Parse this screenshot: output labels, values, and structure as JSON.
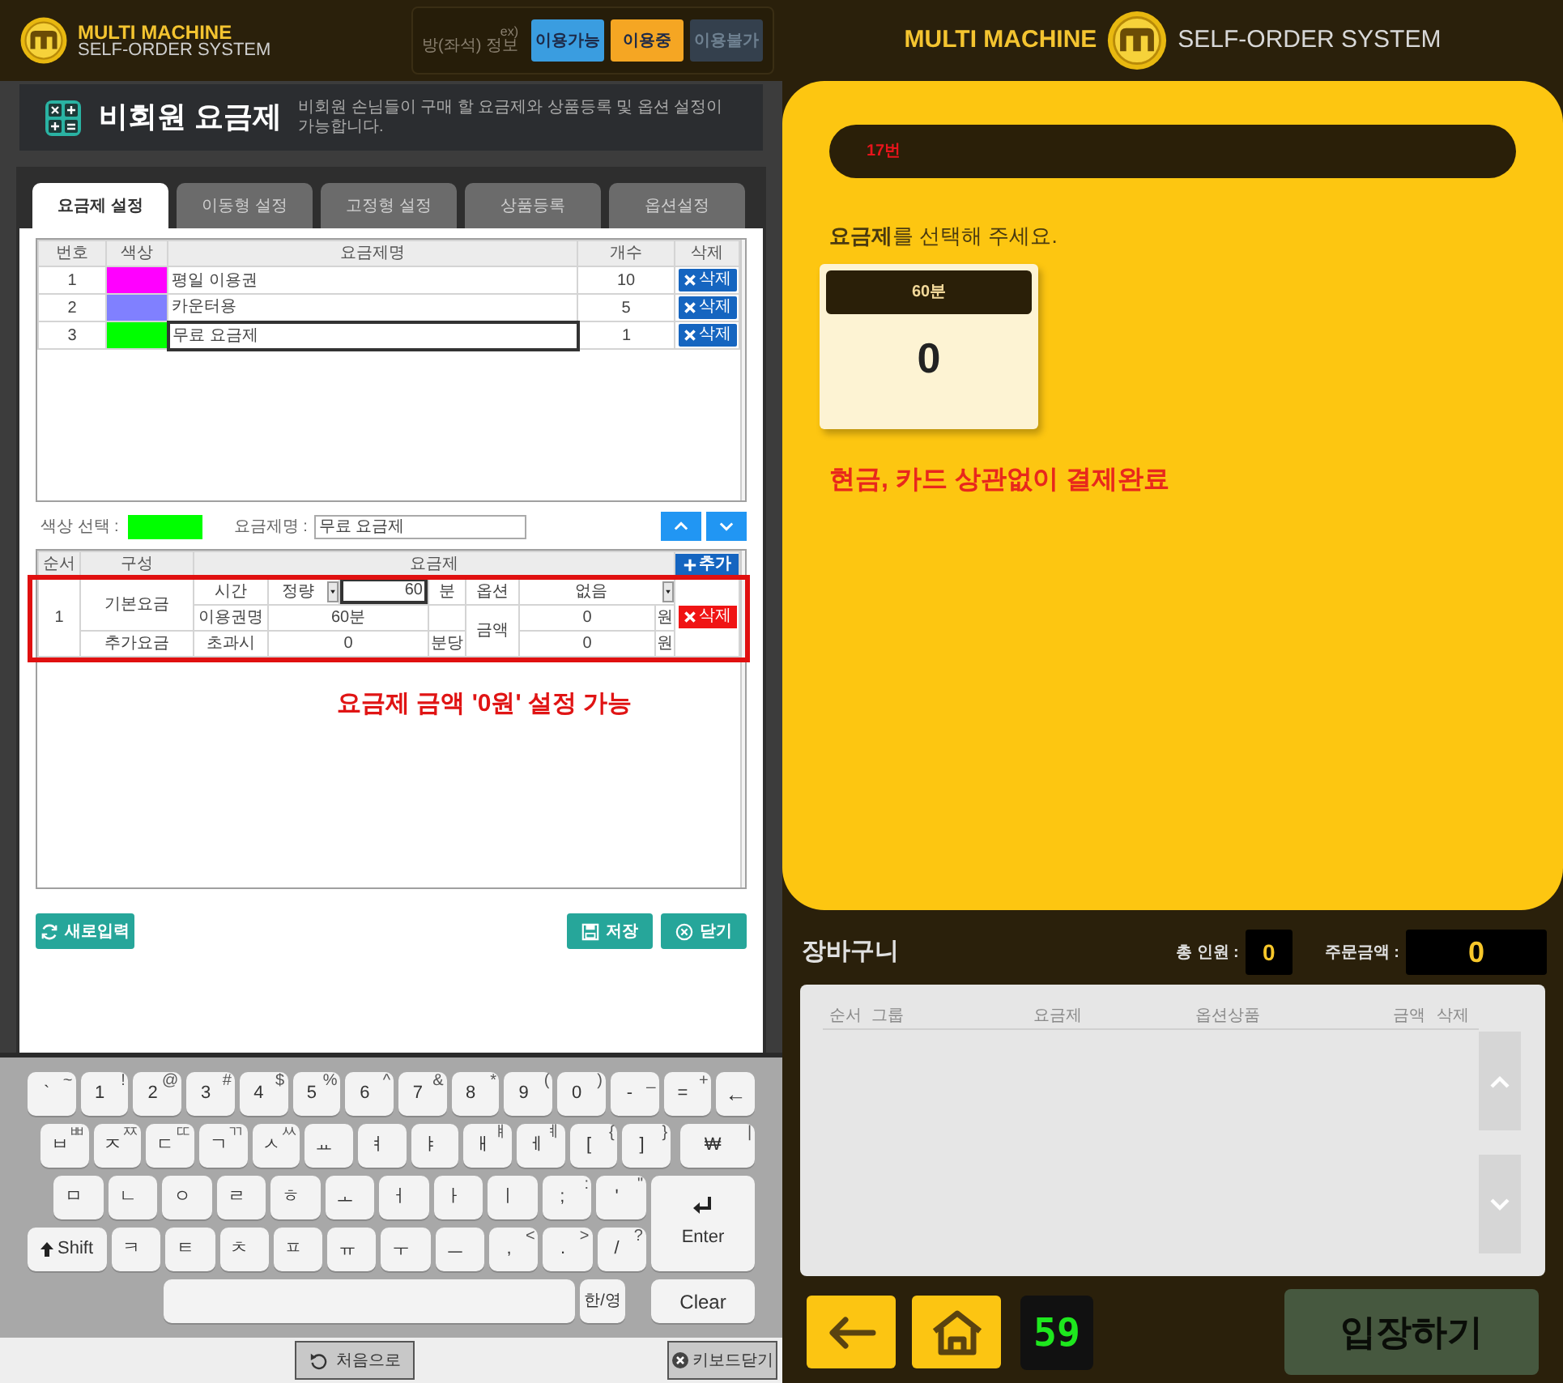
{
  "admin": {
    "header": {
      "brand_line1": "MULTI MACHINE",
      "brand_line2": "SELF-ORDER SYSTEM",
      "legend_note": "ex)",
      "legend_label": "방(좌석) 정보",
      "legend": [
        {
          "label": "이용가능",
          "color": "#3a9de0"
        },
        {
          "label": "이용중",
          "color": "#f5a623"
        },
        {
          "label": "이용불가",
          "color": "#34404d"
        }
      ]
    },
    "page_title": "비회원 요금제",
    "page_description": "비회원 손님들이 구매 할 요금제와 상품등록 및 옵션 설정이 가능합니다.",
    "tabs": [
      {
        "label": "요금제 설정",
        "selected": true
      },
      {
        "label": "이동형 설정",
        "selected": false
      },
      {
        "label": "고정형 설정",
        "selected": false
      },
      {
        "label": "상품등록",
        "selected": false
      },
      {
        "label": "옵션설정",
        "selected": false
      }
    ],
    "plan_table": {
      "columns": [
        "번호",
        "색상",
        "요금제명",
        "개수",
        "삭제"
      ],
      "rows": [
        {
          "number": "1",
          "color": "#ff00ff",
          "name": "평일 이용권",
          "count": "10",
          "delete": "삭제",
          "selected": false
        },
        {
          "number": "2",
          "color": "#8080ff",
          "name": "카운터용",
          "count": "5",
          "delete": "삭제",
          "selected": false
        },
        {
          "number": "3",
          "color": "#00ff00",
          "name": "무료 요금제",
          "count": "1",
          "delete": "삭제",
          "selected": true
        }
      ]
    },
    "color_select": {
      "label": "색상 선택 :",
      "color": "#00ff00"
    },
    "plan_name": {
      "label": "요금제명 :",
      "value": "무료 요금제"
    },
    "detail_table": {
      "columns": [
        "순서",
        "구성",
        "요금제"
      ],
      "add_button": "추가",
      "row": {
        "order": "1",
        "base_label": "기본요금",
        "time_label": "시간",
        "time_mode": "정량",
        "time_value": "60",
        "time_unit": "분",
        "option_label": "옵션",
        "option_value": "없음",
        "ticket_label": "이용권명",
        "ticket_value": "60분",
        "amount_label": "금액",
        "base_amount": "0",
        "base_won": "원",
        "extra_label": "추가요금",
        "over_label": "초과시",
        "over_value": "0",
        "per_unit": "분당",
        "extra_amount": "0",
        "extra_won": "원",
        "delete": "삭제"
      }
    },
    "annotation": "요금제 금액 '0원' 설정 가능",
    "buttons": {
      "reset": "새로입력",
      "save": "저장",
      "close": "닫기"
    }
  },
  "keyboard": {
    "rows": [
      [
        {
          "kind": "char",
          "label": "`",
          "shift": "~"
        },
        {
          "kind": "char",
          "label": "1",
          "shift": "!"
        },
        {
          "kind": "char",
          "label": "2",
          "shift": "@"
        },
        {
          "kind": "char",
          "label": "3",
          "shift": "#"
        },
        {
          "kind": "char",
          "label": "4",
          "shift": "$"
        },
        {
          "kind": "char",
          "label": "5",
          "shift": "%"
        },
        {
          "kind": "char",
          "label": "6",
          "shift": "^"
        },
        {
          "kind": "char",
          "label": "7",
          "shift": "&"
        },
        {
          "kind": "char",
          "label": "8",
          "shift": "*"
        },
        {
          "kind": "char",
          "label": "9",
          "shift": "("
        },
        {
          "kind": "char",
          "label": "0",
          "shift": ")"
        },
        {
          "kind": "char",
          "label": "-",
          "shift": "_"
        },
        {
          "kind": "char",
          "label": "=",
          "shift": "+"
        },
        {
          "kind": "backspace",
          "label": "←"
        }
      ],
      [
        {
          "kind": "char",
          "label": "ㅂ",
          "shift": "ㅃ"
        },
        {
          "kind": "char",
          "label": "ㅈ",
          "shift": "ㅉ"
        },
        {
          "kind": "char",
          "label": "ㄷ",
          "shift": "ㄸ"
        },
        {
          "kind": "char",
          "label": "ㄱ",
          "shift": "ㄲ"
        },
        {
          "kind": "char",
          "label": "ㅅ",
          "shift": "ㅆ"
        },
        {
          "kind": "char",
          "label": "ㅛ"
        },
        {
          "kind": "char",
          "label": "ㅕ"
        },
        {
          "kind": "char",
          "label": "ㅑ"
        },
        {
          "kind": "char",
          "label": "ㅐ",
          "shift": "ㅒ"
        },
        {
          "kind": "char",
          "label": "ㅔ",
          "shift": "ㅖ"
        },
        {
          "kind": "char",
          "label": "[",
          "shift": "{"
        },
        {
          "kind": "char",
          "label": "]",
          "shift": "}"
        },
        {
          "kind": "char",
          "label": "₩",
          "shift": "|"
        }
      ],
      [
        {
          "kind": "char",
          "label": "ㅁ"
        },
        {
          "kind": "char",
          "label": "ㄴ"
        },
        {
          "kind": "char",
          "label": "ㅇ"
        },
        {
          "kind": "char",
          "label": "ㄹ"
        },
        {
          "kind": "char",
          "label": "ㅎ"
        },
        {
          "kind": "char",
          "label": "ㅗ"
        },
        {
          "kind": "char",
          "label": "ㅓ"
        },
        {
          "kind": "char",
          "label": "ㅏ"
        },
        {
          "kind": "char",
          "label": "ㅣ"
        },
        {
          "kind": "char",
          "label": ";",
          "shift": ":"
        },
        {
          "kind": "char",
          "label": "'",
          "shift": "\""
        }
      ],
      [
        {
          "kind": "shift",
          "label": "Shift"
        },
        {
          "kind": "char",
          "label": "ㅋ"
        },
        {
          "kind": "char",
          "label": "ㅌ"
        },
        {
          "kind": "char",
          "label": "ㅊ"
        },
        {
          "kind": "char",
          "label": "ㅍ"
        },
        {
          "kind": "char",
          "label": "ㅠ"
        },
        {
          "kind": "char",
          "label": "ㅜ"
        },
        {
          "kind": "char",
          "label": "ㅡ"
        },
        {
          "kind": "char",
          "label": ",",
          "shift": "<"
        },
        {
          "kind": "char",
          "label": ".",
          "shift": ">"
        },
        {
          "kind": "char",
          "label": "/",
          "shift": "?"
        }
      ],
      [
        {
          "kind": "space"
        },
        {
          "kind": "lang",
          "label": "한/영"
        },
        {
          "kind": "clear",
          "label": "Clear"
        }
      ]
    ],
    "enter_key": {
      "kind": "enter",
      "label": "Enter"
    }
  },
  "bottom_bar": {
    "home": "처음으로",
    "close_keyboard": "키보드닫기"
  },
  "kiosk": {
    "brand_left": "MULTI MACHINE",
    "brand_right": "SELF-ORDER SYSTEM",
    "seat": "17번",
    "prompt": "**요금제**를 선택해 주세요.",
    "plans": [
      {
        "name": "60분",
        "price": "0"
      }
    ],
    "notice": "현금, 카드 상관없이 결제완료",
    "cart": {
      "title": "장바구니",
      "people_label": "총 인원 :",
      "people": "0",
      "total_label": "주문금액 :",
      "total": "0",
      "columns": [
        "순서",
        "그룹",
        "요금제",
        "옵션상품",
        "금액",
        "삭제"
      ]
    },
    "timer": "59",
    "enter": {
      "label": "입장하기",
      "disabled": true
    }
  }
}
